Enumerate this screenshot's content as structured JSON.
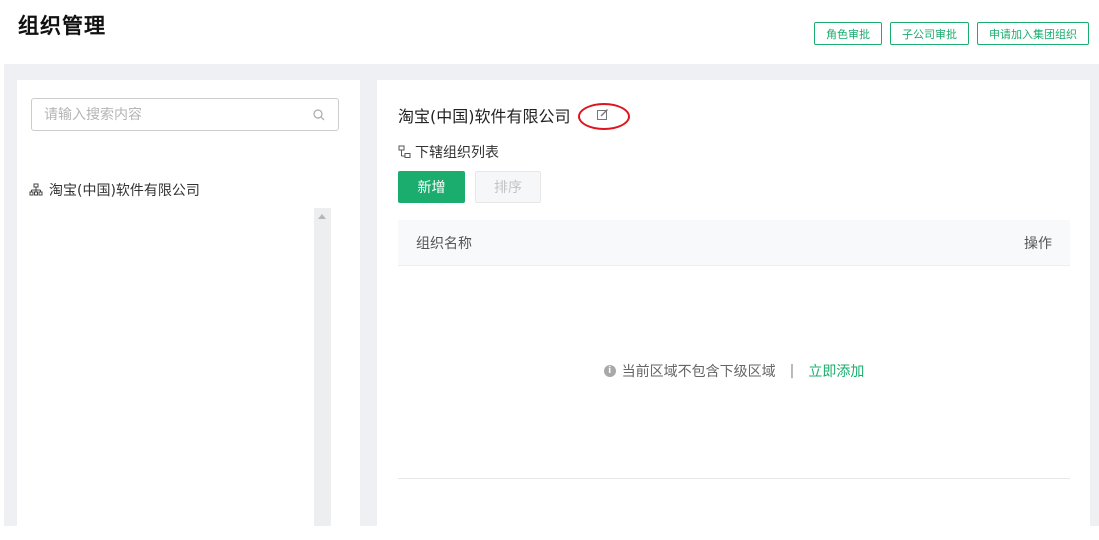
{
  "header": {
    "title": "组织管理",
    "actions": [
      "角色审批",
      "子公司审批",
      "申请加入集团组织"
    ]
  },
  "sidebar": {
    "search_placeholder": "请输入搜索内容",
    "tree": [
      {
        "label": "淘宝(中国)软件有限公司",
        "icon": "org-tree-icon"
      }
    ]
  },
  "main": {
    "org_name": "淘宝(中国)软件有限公司",
    "sub_list_label": "下辖组织列表",
    "add_label": "新增",
    "sort_label": "排序",
    "table": {
      "columns": [
        "组织名称",
        "操作"
      ],
      "rows": [],
      "empty_text": "当前区域不包含下级区域",
      "separator": "|",
      "empty_action": "立即添加"
    }
  },
  "colors": {
    "accent": "#1aad6e",
    "annotation": "#e0141e",
    "panel_bg": "#eef0f3"
  }
}
